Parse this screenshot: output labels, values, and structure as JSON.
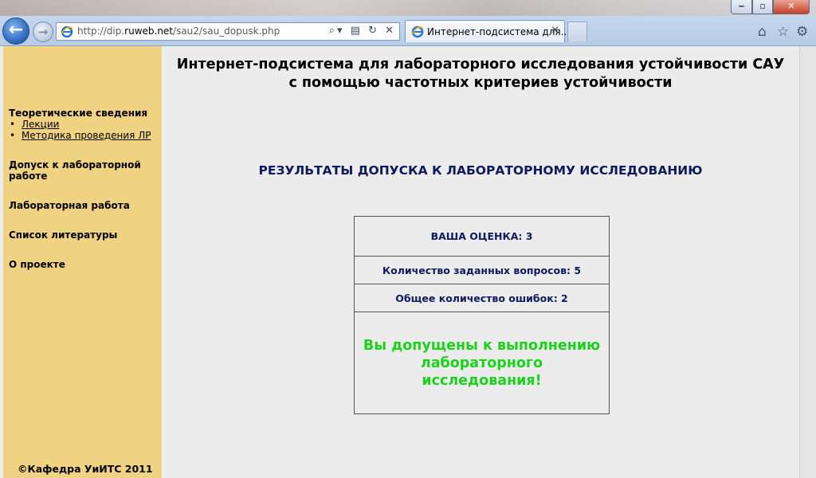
{
  "browser": {
    "url_prefix": "http://dip.",
    "url_domain": "ruweb.net",
    "url_path": "/sau2/sau_dopusk.php",
    "address_tools": "⌕▾ ▤ ↻ ✕",
    "tab_title": "Интернет-подсистема для...",
    "tab_close": "✕",
    "back_glyph": "←",
    "forward_glyph": "→",
    "icons": [
      "home-icon",
      "favorites-star-icon",
      "tools-gear-icon"
    ],
    "home_glyph": "⌂",
    "star_glyph": "☆",
    "gear_glyph": "⚙",
    "window_controls": {
      "minimize": "‒",
      "maximize": "▫",
      "close": "✕"
    }
  },
  "sidebar": {
    "section_theory": "Теоретические сведения",
    "theory_links": [
      "Лекции",
      "Методика проведения ЛР"
    ],
    "section_admission": "Допуск к лабораторной работе",
    "section_lab": "Лабораторная работа",
    "section_literature": "Список литературы",
    "section_about": "О проекте",
    "copyright": "©Кафедра УиИТС 2011"
  },
  "main": {
    "title_line1": "Интернет-подсистема для лабораторного исследования устойчивости САУ",
    "title_line2": "с помощью частотных критериев устойчивости",
    "results_heading": "РЕЗУЛЬТАТЫ ДОПУСКА К ЛАБОРАТОРНОМУ ИССЛЕДОВАНИЮ",
    "grade": "ВАША ОЦЕНКА: 3",
    "questions": "Количество заданных вопросов: 5",
    "errors": "Общее количество ошибок: 2",
    "admission_message": "Вы допущены к выполнению лабораторного исследования!"
  },
  "colors": {
    "sidebar_bg": "#f0d382",
    "content_bg": "#ececec",
    "heading_navy": "#0f1a5c",
    "success_green": "#1bd11b"
  }
}
